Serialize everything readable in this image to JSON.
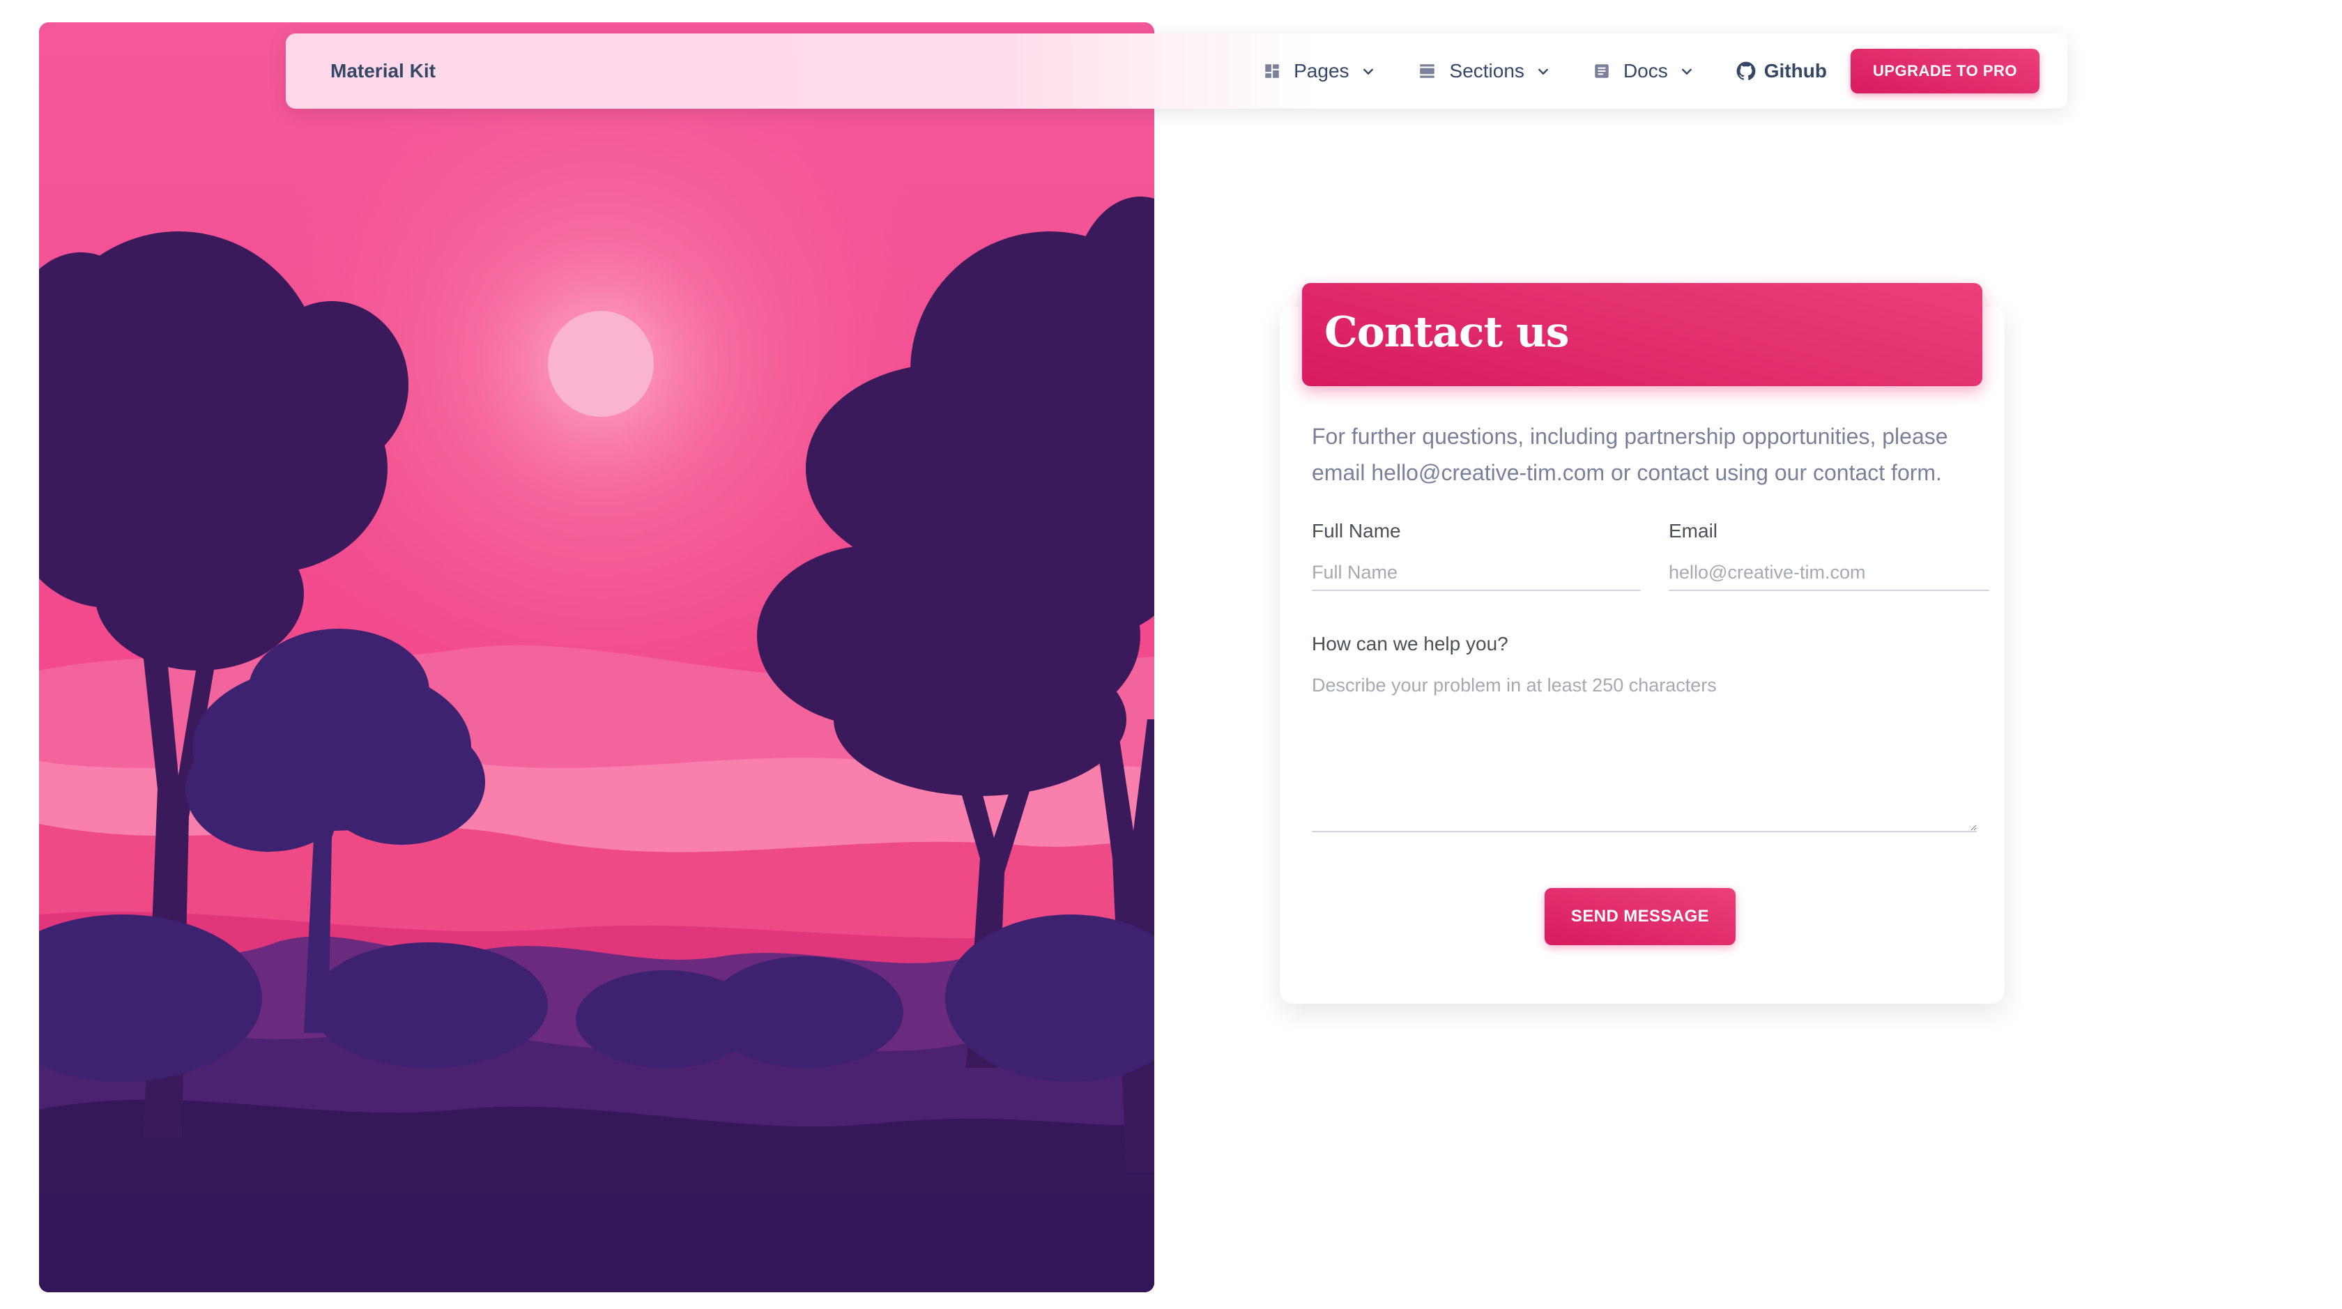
{
  "navbar": {
    "brand": "Material Kit",
    "items": [
      {
        "label": "Pages",
        "icon": "dashboard-icon"
      },
      {
        "label": "Sections",
        "icon": "view-day-icon"
      },
      {
        "label": "Docs",
        "icon": "article-icon"
      }
    ],
    "github": {
      "label": "Github",
      "icon": "github-icon"
    },
    "cta_label": "UPGRADE TO PRO"
  },
  "contact": {
    "title": "Contact us",
    "intro": "For further questions, including partnership opportunities, please email hello@creative-tim.com or contact using our contact form.",
    "full_name": {
      "label": "Full Name",
      "placeholder": "Full Name"
    },
    "email": {
      "label": "Email",
      "placeholder": "hello@creative-tim.com"
    },
    "message": {
      "label": "How can we help you?",
      "placeholder": "Describe your problem in at least 250 characters"
    },
    "submit_label": "SEND MESSAGE"
  },
  "colors": {
    "accent": "#e91e63",
    "text": "#344767",
    "muted": "#7b809a",
    "hero_sky": "#f2558f",
    "hero_trees": "#3b1a5c"
  }
}
